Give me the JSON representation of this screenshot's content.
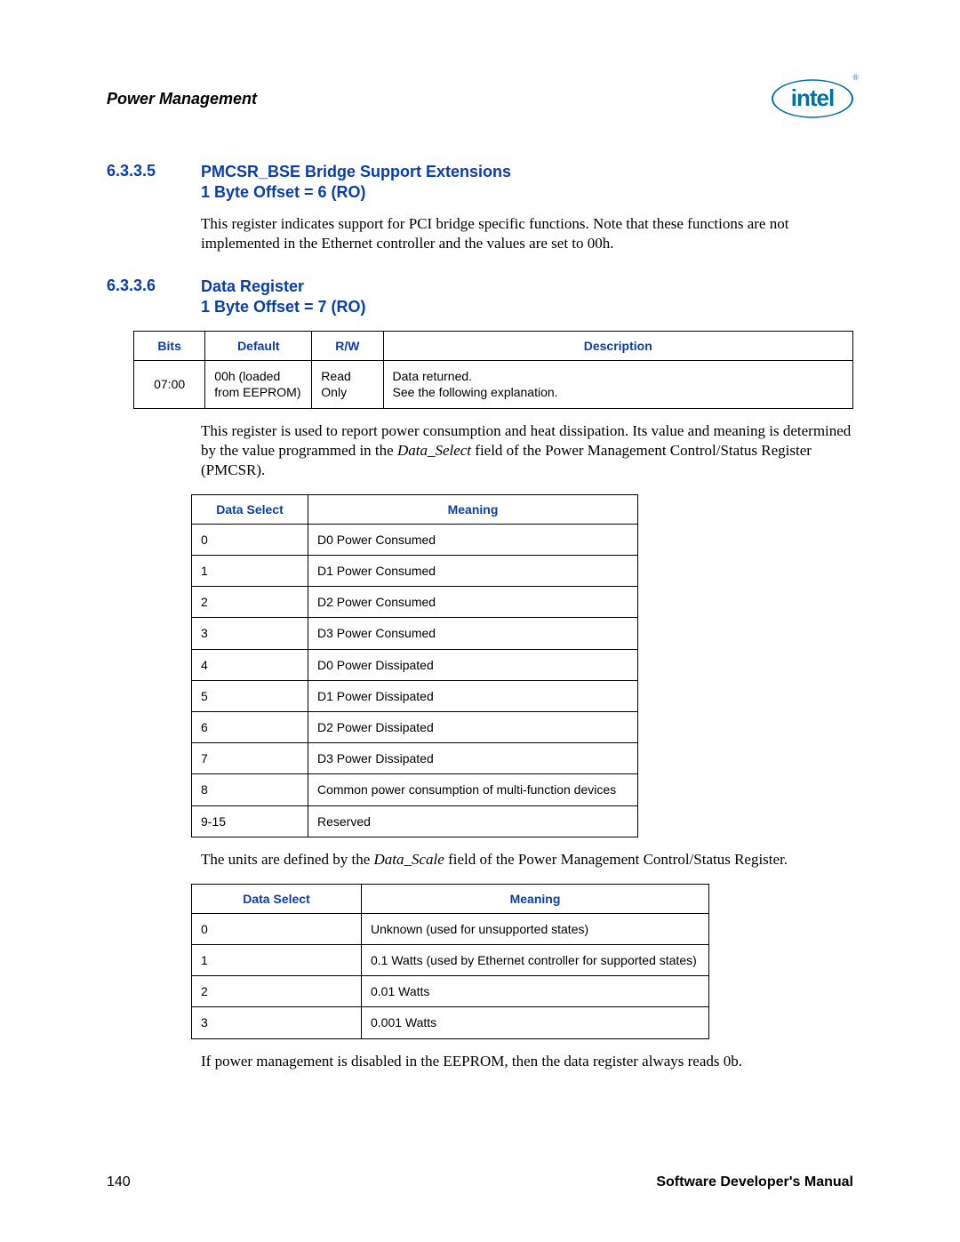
{
  "header": {
    "title": "Power Management",
    "logo_text": "intel",
    "logo_r": "®"
  },
  "s1": {
    "num": "6.3.3.5",
    "title": "PMCSR_BSE Bridge Support Extensions",
    "sub": "1 Byte Offset = 6 (RO)",
    "para": "This register indicates support for PCI bridge specific functions. Note that these functions are not implemented in the Ethernet controller and the values are set to 00h."
  },
  "s2": {
    "num": "6.3.3.6",
    "title": "Data Register",
    "sub": "1 Byte Offset = 7 (RO)"
  },
  "table1": {
    "headers": {
      "c1": "Bits",
      "c2": "Default",
      "c3": "R/W",
      "c4": "Description"
    },
    "row": {
      "bits": "07:00",
      "def": "00h (loaded from EEPROM)",
      "rw": "Read Only",
      "desc1": "Data returned.",
      "desc2": "See the following explanation."
    }
  },
  "para2a": "This register is used to report power consumption and heat dissipation. Its value and meaning is determined by the value programmed in the ",
  "para2b": "Data_Select",
  "para2c": " field of the Power Management Control/Status Register (PMCSR).",
  "table2": {
    "h1": "Data Select",
    "h2": "Meaning",
    "rows": [
      {
        "a": "0",
        "b": "D0 Power Consumed"
      },
      {
        "a": "1",
        "b": "D1 Power Consumed"
      },
      {
        "a": "2",
        "b": "D2 Power Consumed"
      },
      {
        "a": "3",
        "b": "D3 Power Consumed"
      },
      {
        "a": "4",
        "b": "D0 Power Dissipated"
      },
      {
        "a": "5",
        "b": "D1 Power Dissipated"
      },
      {
        "a": "6",
        "b": "D2 Power Dissipated"
      },
      {
        "a": "7",
        "b": "D3 Power Dissipated"
      },
      {
        "a": "8",
        "b": "Common power consumption of multi-function devices"
      },
      {
        "a": "9-15",
        "b": "Reserved"
      }
    ]
  },
  "para3a": "The units are defined by the ",
  "para3b": "Data_Scale",
  "para3c": " field of the Power Management Control/Status Register.",
  "table3": {
    "h1": "Data Select",
    "h2": "Meaning",
    "rows": [
      {
        "a": "0",
        "b": "Unknown (used for unsupported states)"
      },
      {
        "a": "1",
        "b": "0.1 Watts (used by Ethernet controller for supported states)"
      },
      {
        "a": "2",
        "b": "0.01 Watts"
      },
      {
        "a": "3",
        "b": "0.001 Watts"
      }
    ]
  },
  "para4": "If power management is disabled in the EEPROM, then the data register always reads 0b.",
  "footer": {
    "page": "140",
    "doc": "Software Developer's Manual"
  }
}
